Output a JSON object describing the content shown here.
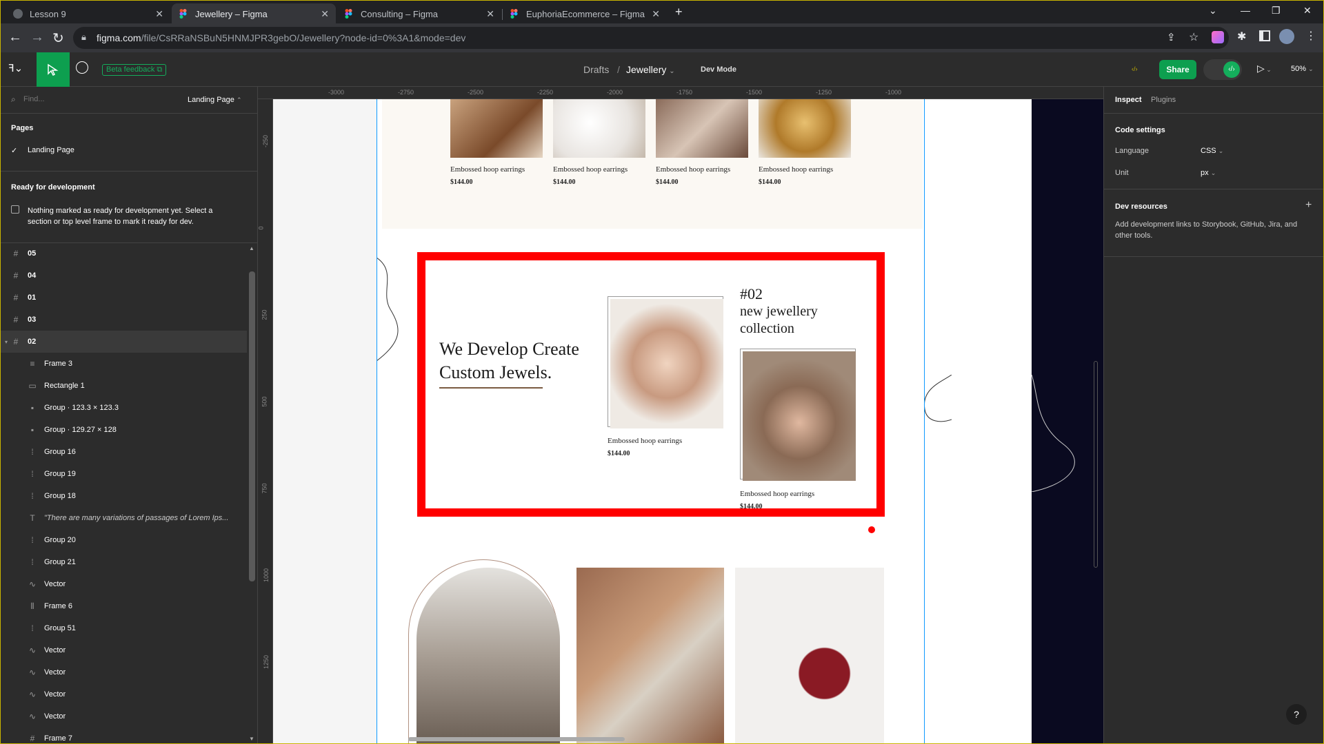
{
  "browser": {
    "tabs": [
      {
        "label": "Lesson 9"
      },
      {
        "label": "Jewellery – Figma"
      },
      {
        "label": "Consulting – Figma"
      },
      {
        "label": "EuphoriaEcommerce – Figma"
      }
    ],
    "url_host": "figma.com",
    "url_path": "/file/CsRRaNSBuN5HNMJPR3gebO/Jewellery?node-id=0%3A1&mode=dev"
  },
  "toolbar": {
    "beta_label": "Beta feedback",
    "crumb_drafts": "Drafts",
    "crumb_sep": "/",
    "crumb_file": "Jewellery",
    "mode_label": "Dev Mode",
    "share_label": "Share",
    "zoom": "50%"
  },
  "left": {
    "find_placeholder": "Find...",
    "current_page": "Landing Page",
    "pages_title": "Pages",
    "pages": [
      "Landing Page"
    ],
    "ready_title": "Ready for development",
    "ready_msg_1": "Nothing marked as ready for development yet. Select a",
    "ready_msg_2": "section or top level frame to mark it ready for dev.",
    "layers": [
      {
        "label": "05",
        "icon": "#",
        "level": 0
      },
      {
        "label": "04",
        "icon": "#",
        "level": 0
      },
      {
        "label": "01",
        "icon": "#",
        "level": 0
      },
      {
        "label": "03",
        "icon": "#",
        "level": 0
      },
      {
        "label": "02",
        "icon": "#",
        "level": 0
      },
      {
        "label": "Frame 3",
        "icon": "≡",
        "level": 1
      },
      {
        "label": "Rectangle 1",
        "icon": "▭",
        "level": 1
      },
      {
        "label": "Group · 123.3 × 123.3",
        "icon": "▪",
        "level": 1
      },
      {
        "label": "Group · 129.27 × 128",
        "icon": "▪",
        "level": 1
      },
      {
        "label": "Group 16",
        "icon": "⁞",
        "level": 1
      },
      {
        "label": "Group 19",
        "icon": "⁞",
        "level": 1
      },
      {
        "label": "Group 18",
        "icon": "⁞",
        "level": 1
      },
      {
        "label": "\"There are many variations of passages of Lorem Ips...",
        "icon": "T",
        "level": 1
      },
      {
        "label": "Group 20",
        "icon": "⁞",
        "level": 1
      },
      {
        "label": "Group 21",
        "icon": "⁞",
        "level": 1
      },
      {
        "label": "Vector",
        "icon": "∿",
        "level": 1
      },
      {
        "label": "Frame 6",
        "icon": "⦀",
        "level": 1
      },
      {
        "label": "Group 51",
        "icon": "⁞",
        "level": 1
      },
      {
        "label": "Vector",
        "icon": "∿",
        "level": 1
      },
      {
        "label": "Vector",
        "icon": "∿",
        "level": 1
      },
      {
        "label": "Vector",
        "icon": "∿",
        "level": 1
      },
      {
        "label": "Vector",
        "icon": "∿",
        "level": 1
      },
      {
        "label": "Frame 7",
        "icon": "#",
        "level": 1
      }
    ]
  },
  "rulers": {
    "h": [
      "-3000",
      "-2750",
      "-2500",
      "-2250",
      "-2000",
      "-1750",
      "-1500",
      "-1250",
      "-1000"
    ],
    "v": [
      "-250",
      "0",
      "250",
      "500",
      "750",
      "1000",
      "1250"
    ]
  },
  "right": {
    "tab_inspect": "Inspect",
    "tab_plugins": "Plugins",
    "code_settings": "Code settings",
    "language_label": "Language",
    "language_value": "CSS",
    "unit_label": "Unit",
    "unit_value": "px",
    "dev_resources": "Dev resources",
    "dev_resources_desc_1": "Add development links to Storybook, GitHub, Jira, and",
    "dev_resources_desc_2": "other tools."
  },
  "design": {
    "top_products": [
      {
        "name": "Embossed hoop earrings",
        "price": "$144.00"
      },
      {
        "name": "Embossed hoop earrings",
        "price": "$144.00"
      },
      {
        "name": "Embossed hoop earrings",
        "price": "$144.00"
      },
      {
        "name": "Embossed hoop earrings",
        "price": "$144.00"
      }
    ],
    "headline_1": "We Develop Create",
    "headline_2": "Custom Jewels.",
    "collection_num": "#02",
    "collection_line1": "new jewellery",
    "collection_line2": "collection",
    "card1": {
      "name": "Embossed hoop earrings",
      "price": "$144.00"
    },
    "card2": {
      "name": "Embossed hoop earrings",
      "price": "$144.00"
    },
    "highlight_color": "#ff0000",
    "accent_green": "#0d9f4f"
  },
  "help_label": "?"
}
